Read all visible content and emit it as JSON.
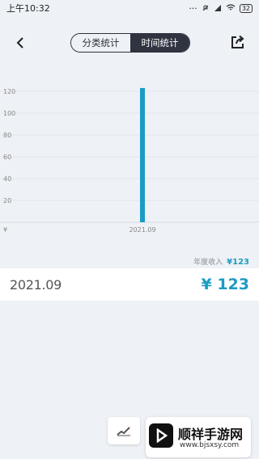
{
  "status_bar": {
    "time": "上午10:32",
    "battery": "32"
  },
  "header": {
    "tabs": [
      {
        "label": "分类统计",
        "active": false
      },
      {
        "label": "时间统计",
        "active": true
      }
    ]
  },
  "chart_data": {
    "type": "bar",
    "categories": [
      "2021.09"
    ],
    "values": [
      123
    ],
    "y_ticks": [
      "120",
      "100",
      "80",
      "60",
      "40",
      "20"
    ],
    "y_unit": "¥",
    "ylim": [
      0,
      130
    ],
    "bar_color": "#1b9bc4",
    "grid": true
  },
  "summary": {
    "year_label": "年度收入",
    "year_amount": "¥123"
  },
  "month_row": {
    "month": "2021.09",
    "amount": "¥ 123"
  },
  "watermark": {
    "title": "顺祥手游网",
    "url": "www.bjsxsy.com"
  },
  "colors": {
    "accent": "#1b9bc4",
    "header_active": "#2f3440",
    "background": "#eef1f5"
  }
}
